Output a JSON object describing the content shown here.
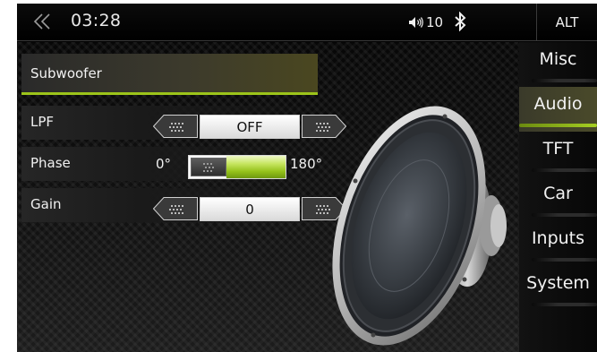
{
  "statusbar": {
    "time": "03:28",
    "volume_value": "10",
    "alt_label": "ALT",
    "icons": [
      "back-chevron-icon",
      "volume-icon",
      "bluetooth-icon"
    ]
  },
  "section": {
    "title": "Subwoofer"
  },
  "settings": {
    "lpf": {
      "label": "LPF",
      "value": "OFF"
    },
    "phase": {
      "label": "Phase",
      "min_label": "0°",
      "max_label": "180°",
      "level": 0.0
    },
    "gain": {
      "label": "Gain",
      "value": "0"
    }
  },
  "sidebar": {
    "items": [
      {
        "label": "Misc",
        "active": false
      },
      {
        "label": "Audio",
        "active": true
      },
      {
        "label": "TFT",
        "active": false
      },
      {
        "label": "Car",
        "active": false
      },
      {
        "label": "Inputs",
        "active": false
      },
      {
        "label": "System",
        "active": false
      }
    ]
  },
  "colors": {
    "accent": "#9cc41a",
    "background": "#000000",
    "text": "#f0f0f0"
  }
}
